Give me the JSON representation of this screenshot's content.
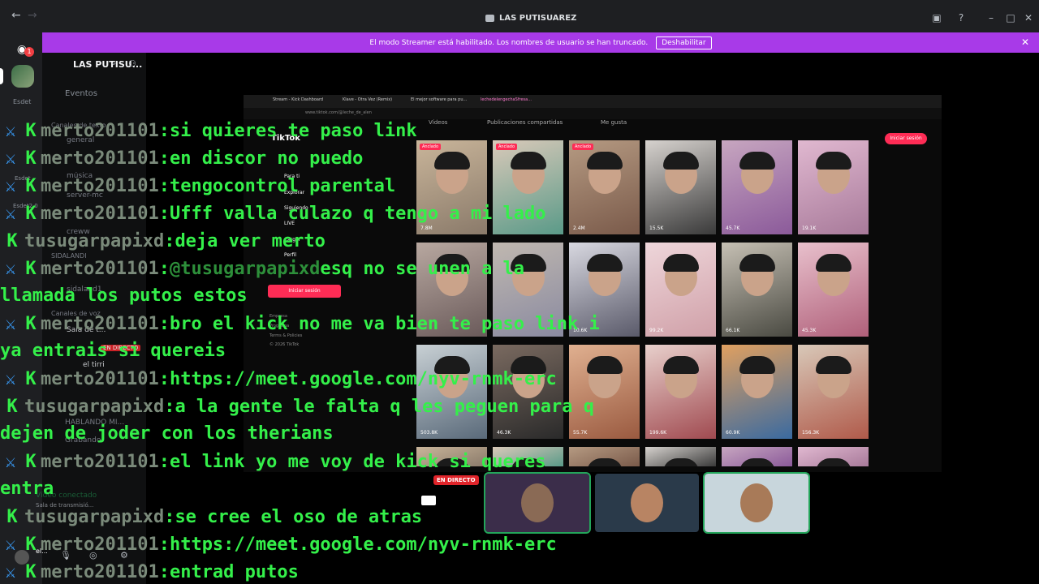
{
  "titlebar": {
    "back": "←",
    "forward": "→",
    "title": "LAS PUTISUAREZ"
  },
  "banner": {
    "text": "El modo Streamer está habilitado. Los nombres de usuario se han truncado.",
    "button": "Deshabilitar",
    "close": "✕"
  },
  "server": {
    "name": "LAS PUTISU...",
    "badge_count": "1"
  },
  "sidebar": {
    "events": "Eventos",
    "text_category": "Canales de texto",
    "channels": [
      "general",
      "música",
      "server-mc",
      "creww"
    ],
    "group": "SIDALANDI",
    "group_channel": "sidaland1",
    "voice_category": "Canales de voz",
    "voice_channel": "Sala de t...",
    "voice_user": "el tirri",
    "voice_channel_2": "HABLANDO MI...",
    "recording": "Grabando",
    "live_label": "EN DIRECTO",
    "side_labels": [
      "Esdet",
      "Esdet",
      "Esdet2.0"
    ]
  },
  "stream": {
    "browser_tabs": [
      "Stream - Kick Dashboard",
      "Klave - Otra Vez (Remix)",
      "El mejor software para pu...",
      "lechedelengechaSfresa..."
    ],
    "url": "www.tiktok.com/@leche_de_alen",
    "logo": "TikTok",
    "nav": [
      "Para ti",
      "Explorar",
      "Siguiendo",
      "LIVE",
      "Cargar",
      "Perfil"
    ],
    "login_button": "Iniciar sesión",
    "footer": [
      "Empresa",
      "Programa",
      "Terms & Policies",
      "© 2026 TikTok"
    ],
    "content_tabs": [
      "Vídeos",
      "Publicaciones compartidas",
      "Me gusta"
    ],
    "login_button_right": "Iniciar sesión",
    "pinned_label": "Anclado",
    "views": [
      "7.8M",
      "",
      "2.4M",
      "15.5K",
      "45.7K",
      "19.1K",
      "",
      "",
      "10.6K",
      "99.2K",
      "66.1K",
      "45.3K",
      "503.8K",
      "46.3K",
      "55.7K",
      "199.6K",
      "60.9K",
      "156.3K"
    ]
  },
  "chat": [
    {
      "badges": "sword-k",
      "user": "merto201101",
      "msg": "si quieres te paso link"
    },
    {
      "badges": "sword-k",
      "user": "merto201101",
      "msg": "en discor no puedo"
    },
    {
      "badges": "sword-k",
      "user": "merto201101",
      "msg": "tengocontrol parental"
    },
    {
      "badges": "sword-k",
      "user": "merto201101",
      "msg": "Ufff valla culazo q tengo a mi lado"
    },
    {
      "badges": "k",
      "user": "tusugarpapixd",
      "msg": "deja ver merto"
    },
    {
      "badges": "sword-k",
      "user": "merto201101",
      "mention": "@tusugarpapixd",
      "msg": "esq no se unen a la"
    },
    {
      "cont": "llamada los putos estos"
    },
    {
      "badges": "sword-k",
      "user": "merto201101",
      "msg": "bro el kick no me va bien te paso link i"
    },
    {
      "cont": "ya entrais si quereis"
    },
    {
      "badges": "sword-k",
      "user": "merto201101",
      "msg": "https://meet.google.com/nyv-rnmk-erc"
    },
    {
      "badges": "k",
      "user": "tusugarpapixd",
      "msg": "a la gente le falta q les peguen para q"
    },
    {
      "cont": "dejen de joder con los therians"
    },
    {
      "badges": "sword-k",
      "user": "merto201101",
      "msg": "el link yo me voy de kick si queres"
    },
    {
      "cont": "entra"
    },
    {
      "badges": "k",
      "user": "tusugarpapixd",
      "msg": "se cree el oso de atras"
    },
    {
      "badges": "sword-k",
      "user": "merto201101",
      "msg": "https://meet.google.com/nyv-rnmk-erc"
    },
    {
      "badges": "sword-k",
      "user": "merto201101",
      "msg": "entrad putos"
    }
  ],
  "voice": {
    "live_badge": "EN DIRECTO",
    "connected": "Vídeo conectado",
    "sub": "Sala de transmisió..."
  },
  "user_panel": {
    "name": "el..."
  },
  "colors": {
    "banner": "#a83ae8",
    "chat_text": "#34f04a",
    "live": "#e0242a",
    "tiktok": "#fe2c55"
  }
}
